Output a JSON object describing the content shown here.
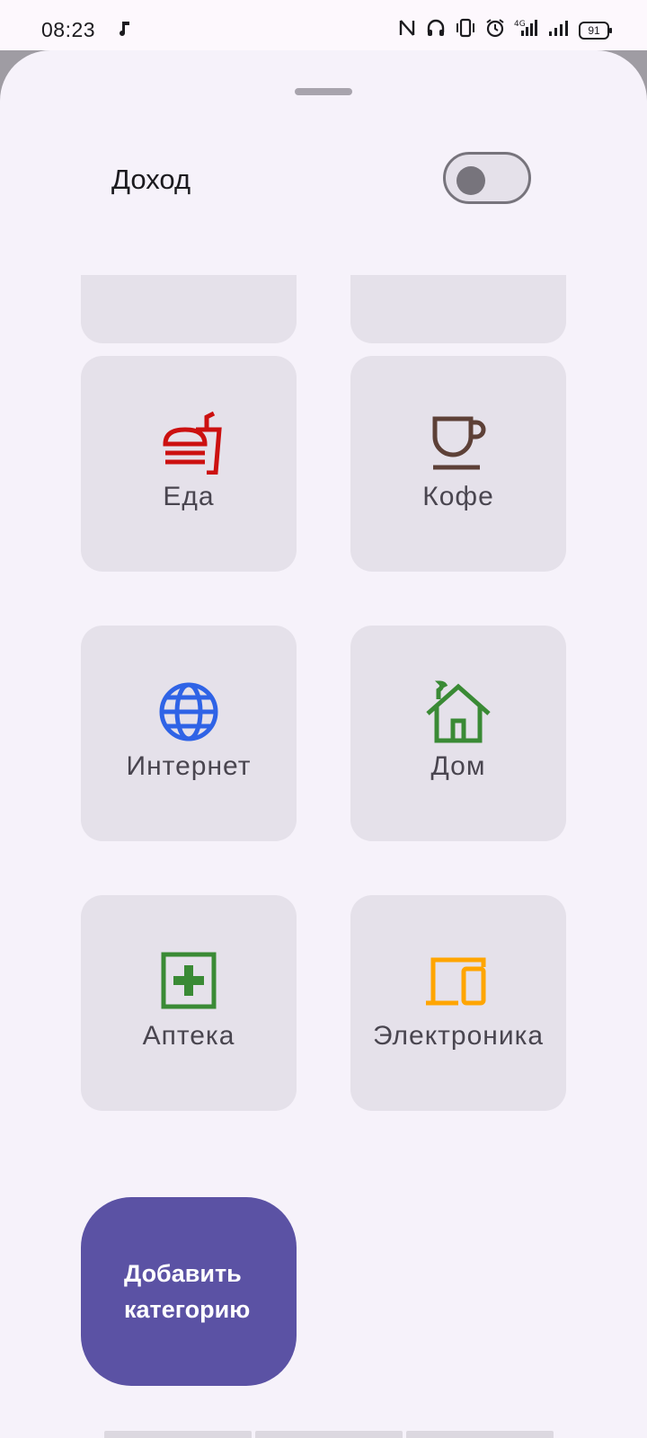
{
  "status_bar": {
    "time": "08:23",
    "battery": "91"
  },
  "sheet": {
    "toggle_label": "Доход",
    "toggle_on": false
  },
  "categories": [
    {
      "label": "Еда",
      "icon": "fastfood-icon",
      "color": "#cc1010"
    },
    {
      "label": "Кофе",
      "icon": "coffee-cup-icon",
      "color": "#5d4037"
    },
    {
      "label": "Интернет",
      "icon": "globe-icon",
      "color": "#2f63e6"
    },
    {
      "label": "Дом",
      "icon": "house-icon",
      "color": "#3a8a35"
    },
    {
      "label": "Аптека",
      "icon": "medical-plus-icon",
      "color": "#3a8a35"
    },
    {
      "label": "Электроника",
      "icon": "devices-icon",
      "color": "#ffa500"
    }
  ],
  "add_button": {
    "line1": "Добавить",
    "line2": "категорию"
  },
  "colors": {
    "accent": "#5b52a4",
    "surface": "#f6f2fa",
    "tile": "#e5e1ea"
  }
}
